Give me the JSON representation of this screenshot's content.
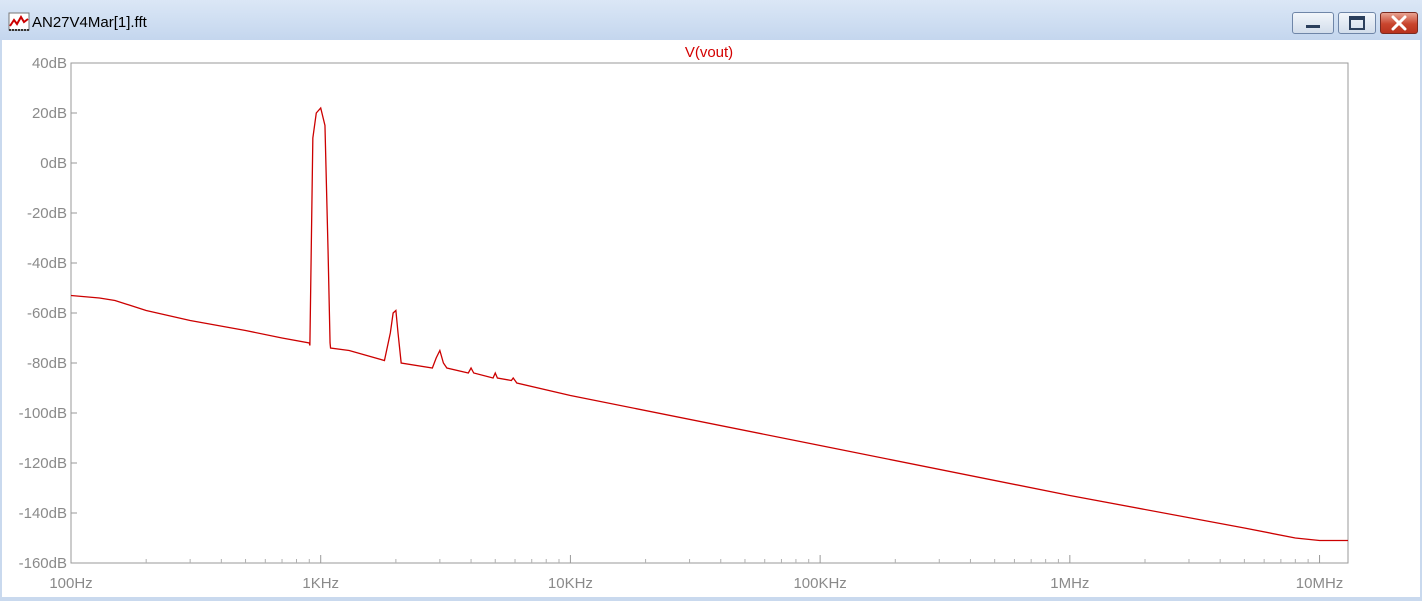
{
  "window": {
    "title": "AN27V4Mar[1].fft"
  },
  "icons": {
    "app": "waveform-icon",
    "minimize": "minimize-icon",
    "maximize": "maximize-icon",
    "close": "close-icon"
  },
  "colors": {
    "trace": "#cc0000",
    "axis_text": "#8a8a8a",
    "plot_bg": "#ffffff",
    "frame": "#c9d9ee"
  },
  "chart_data": {
    "type": "line",
    "title": "V(vout)",
    "xscale": "log",
    "ylim": [
      -160,
      40
    ],
    "xlim": [
      100,
      13000000
    ],
    "grid": false,
    "y_ticks": [
      "40dB",
      "20dB",
      "0dB",
      "-20dB",
      "-40dB",
      "-60dB",
      "-80dB",
      "-100dB",
      "-120dB",
      "-140dB",
      "-160dB"
    ],
    "x_ticks": [
      "100Hz",
      "1KHz",
      "10KHz",
      "100KHz",
      "1MHz",
      "10MHz"
    ],
    "series": [
      {
        "name": "V(vout)",
        "x": [
          100,
          130,
          150,
          200,
          300,
          500,
          700,
          900,
          905,
          930,
          960,
          1000,
          1040,
          1070,
          1090,
          1095,
          1300,
          1800,
          1900,
          1950,
          2000,
          2040,
          2100,
          2800,
          2900,
          3000,
          3100,
          3200,
          3900,
          4000,
          4100,
          4900,
          5000,
          5100,
          5800,
          5900,
          6000,
          6100,
          10000,
          100000,
          1000000,
          5000000,
          8000000,
          10000000,
          13000000
        ],
        "y": [
          -53,
          -54,
          -55,
          -59,
          -63,
          -67,
          -70,
          -72,
          -73,
          10,
          20,
          22,
          15,
          -35,
          -72,
          -74,
          -75,
          -79,
          -68,
          -60,
          -59,
          -68,
          -80,
          -82,
          -78,
          -75,
          -80,
          -82,
          -84,
          -82,
          -84,
          -86,
          -84,
          -86,
          -87,
          -86,
          -87,
          -88,
          -93,
          -113,
          -133,
          -146,
          -150,
          -151,
          -151
        ]
      }
    ]
  }
}
